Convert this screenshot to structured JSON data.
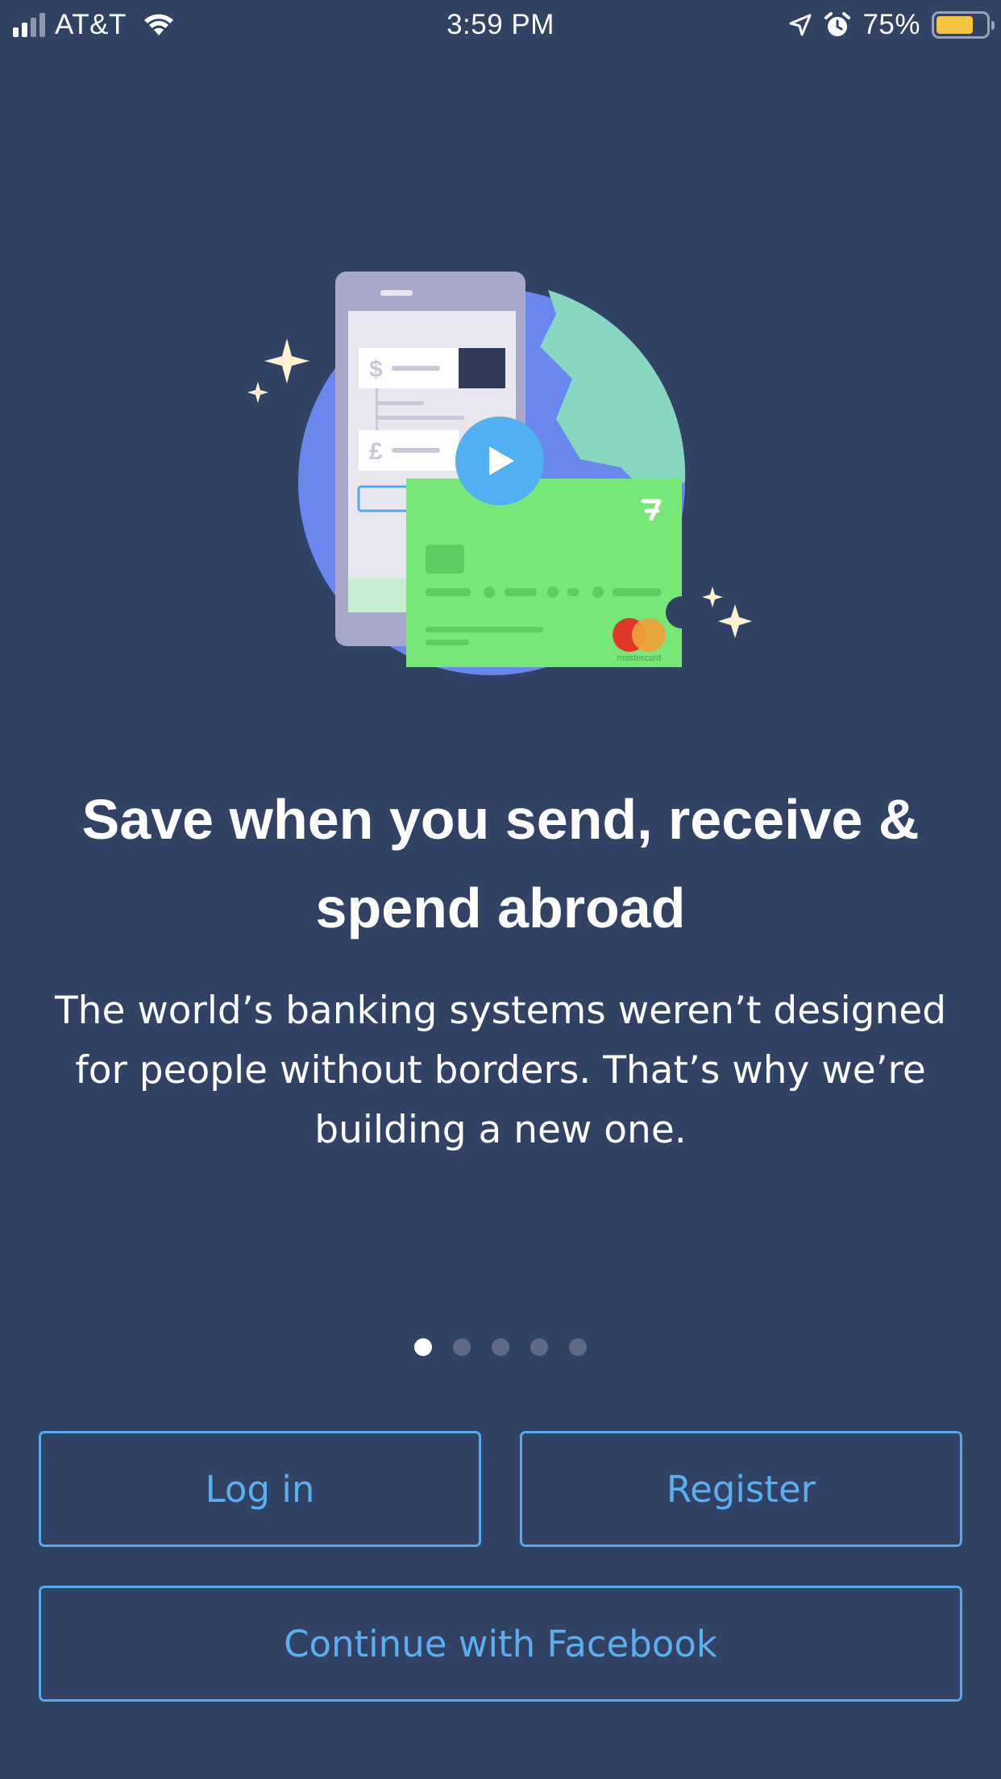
{
  "status_bar": {
    "carrier": "AT&T",
    "time": "3:59 PM",
    "battery_percent": "75%",
    "battery_level": 0.75,
    "battery_color": "#f5c542",
    "icons": [
      "signal-icon",
      "wifi-icon",
      "location-arrow-icon",
      "alarm-icon",
      "battery-icon"
    ]
  },
  "hero": {
    "play_icon": "play-icon",
    "card_brand": "mastercard",
    "currency_symbols": [
      "$",
      "£"
    ]
  },
  "headline": {
    "line1": "Save when you send, receive &",
    "line2": "spend abroad"
  },
  "subtext": {
    "line1": "The world’s banking systems weren’t designed",
    "line2": "for people without borders. That’s why we’re",
    "line3": "building a new one."
  },
  "pager": {
    "total": 5,
    "active_index": 0
  },
  "actions": {
    "login_label": "Log in",
    "register_label": "Register",
    "facebook_label": "Continue with Facebook"
  },
  "colors": {
    "background": "#324264",
    "accent": "#53a9ec",
    "card_green": "#77e878",
    "globe_blue": "#6a86ef",
    "globe_teal": "#86d6c0"
  }
}
